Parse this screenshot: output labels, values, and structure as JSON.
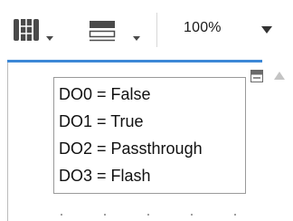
{
  "toolbar": {
    "layout_icon": "grid-layout-icon",
    "rows_icon": "horizontal-rows-icon",
    "zoom_value": "100%",
    "zoom_dropdown_icon": "chevron-down-icon"
  },
  "canvas": {
    "labels": [
      "DO0 = False",
      "DO1 = True",
      "DO2 = Passthrough",
      "DO3 = Flash"
    ],
    "collapse_icon": "collapse-icon",
    "scroll_up_icon": "scroll-up-arrow-icon"
  },
  "colors": {
    "accent_line": "#3c87d6",
    "icon": "#4a4a4a"
  }
}
